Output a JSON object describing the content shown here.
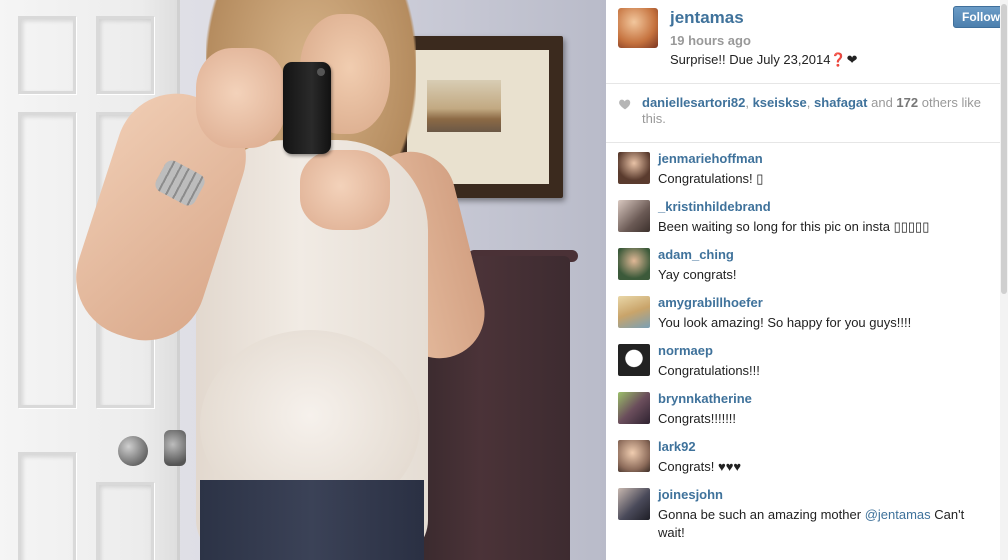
{
  "post": {
    "username": "jentamas",
    "time": "19 hours ago",
    "caption": "Surprise!! Due July 23,2014❓❤",
    "follow_label": "Follow"
  },
  "likes": {
    "users": [
      "daniellesartori82",
      "kseiskse",
      "shafagat"
    ],
    "sep1": ", ",
    "sep2": ", ",
    "and_text": " and ",
    "others_count": "172",
    "others_text": " others like this."
  },
  "comments": [
    {
      "username": "jenmariehoffman",
      "text": "Congratulations! ▯",
      "avatar_color": "#5a3b2e"
    },
    {
      "username": "_kristinhildebrand",
      "text": "Been waiting so long for this pic on insta ▯▯▯▯▯",
      "avatar_color": "#6b5a55"
    },
    {
      "username": "adam_ching",
      "text": "Yay congrats!",
      "avatar_color": "#3c5a3a"
    },
    {
      "username": "amygrabillhoefer",
      "text": "You look amazing! So happy for you guys!!!!",
      "avatar_color": "#c9a46a"
    },
    {
      "username": "normaep",
      "text": "Congratulations!!!",
      "avatar_color": "#222222"
    },
    {
      "username": "brynnkatherine",
      "text": "Congrats!!!!!!!",
      "avatar_color": "#6b4e5c"
    },
    {
      "username": "lark92",
      "text": "Congrats! ♥♥♥",
      "avatar_color": "#8c6b5a"
    },
    {
      "username": "joinesjohn",
      "text_before": "Gonna be such an amazing mother ",
      "mention": "@jentamas",
      "text_after": " Can't wait!",
      "avatar_color": "#4a4a5a"
    }
  ]
}
